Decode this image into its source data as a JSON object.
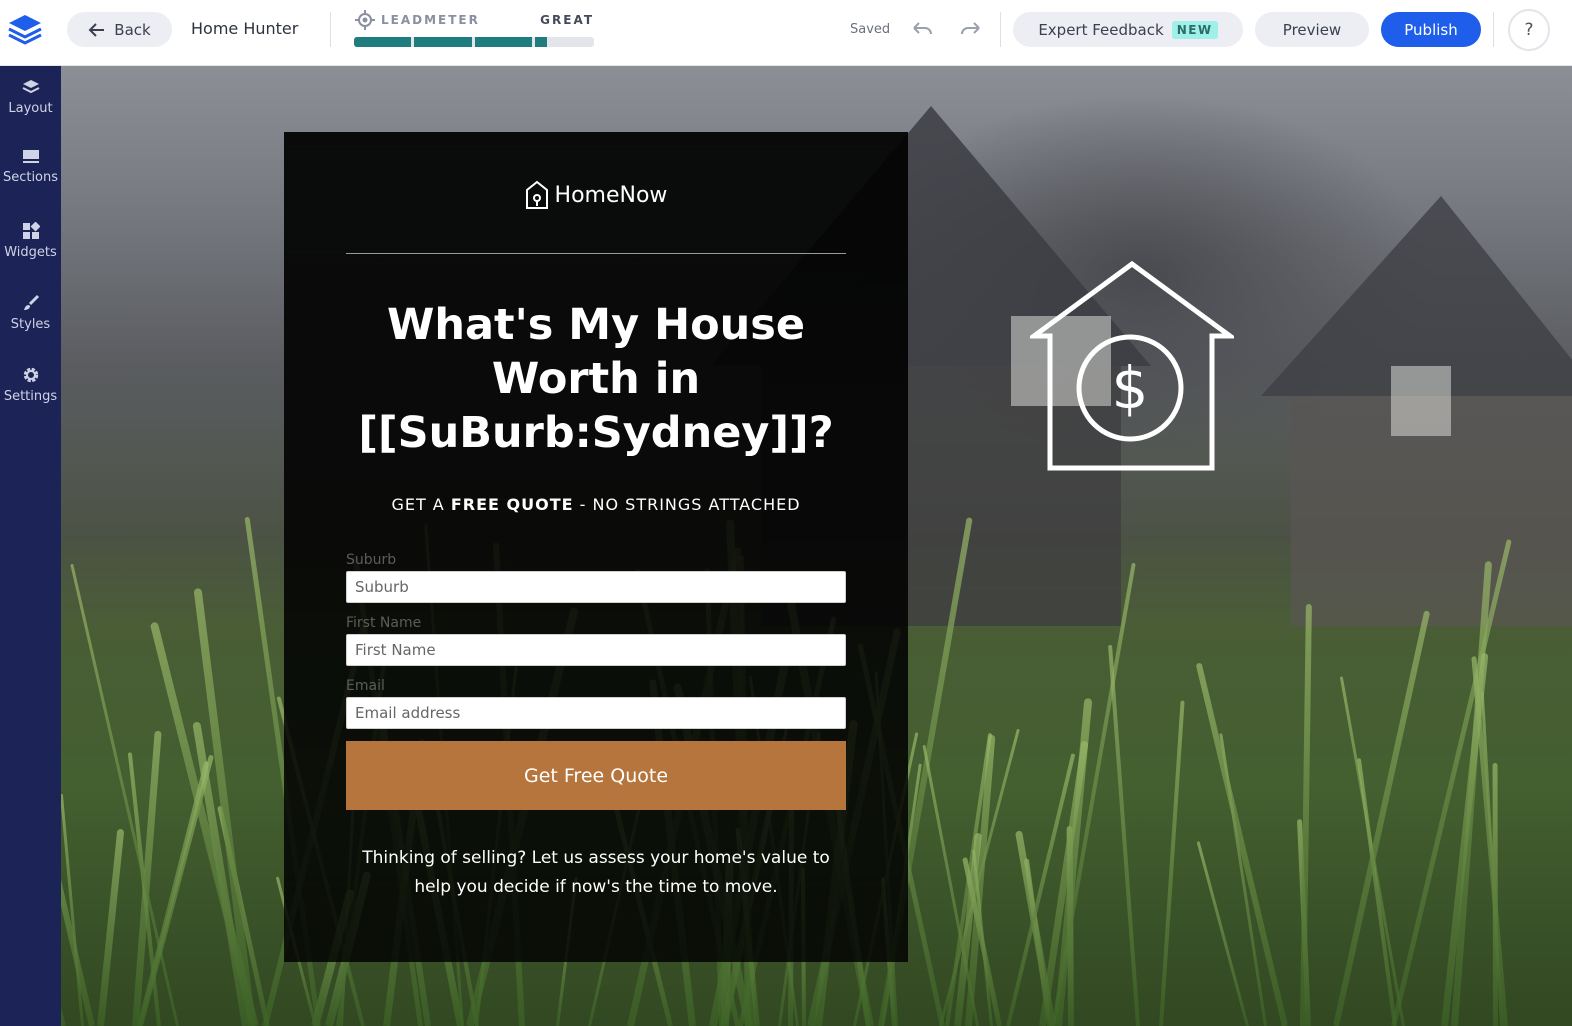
{
  "topbar": {
    "back_label": "Back",
    "page_name": "Home Hunter",
    "leadmeter": {
      "label": "LEADMETER",
      "score": "GREAT",
      "progress": 0.81
    },
    "saved_status": "Saved",
    "expert_feedback_label": "Expert Feedback",
    "new_badge": "NEW",
    "preview_label": "Preview",
    "publish_label": "Publish",
    "help_label": "?"
  },
  "sidebar": {
    "items": [
      {
        "label": "Layout",
        "icon": "layers-icon"
      },
      {
        "label": "Sections",
        "icon": "sections-icon"
      },
      {
        "label": "Widgets",
        "icon": "widgets-icon"
      },
      {
        "label": "Styles",
        "icon": "brush-icon"
      },
      {
        "label": "Settings",
        "icon": "gear-icon"
      }
    ]
  },
  "landing": {
    "brand": "HomeNow",
    "headline": "What's My House Worth in [[SuBurb:Sydney]]?",
    "sub_pre": "GET A ",
    "sub_bold": "FREE QUOTE",
    "sub_post": " - NO STRINGS ATTACHED",
    "fields": [
      {
        "label": "Suburb",
        "placeholder": "Suburb"
      },
      {
        "label": "First Name",
        "placeholder": "First Name"
      },
      {
        "label": "Email",
        "placeholder": "Email address"
      }
    ],
    "cta_label": "Get Free Quote",
    "footer": "Thinking of selling? Let us assess your home's value to help you decide if now's the time to move."
  },
  "colors": {
    "sidebar_bg": "#1c2357",
    "publish_bg": "#1e5eea",
    "leadmeter_fill": "#1f7d7f",
    "cta_bg": "#b5753d",
    "new_badge_bg": "#9ff0e8"
  }
}
